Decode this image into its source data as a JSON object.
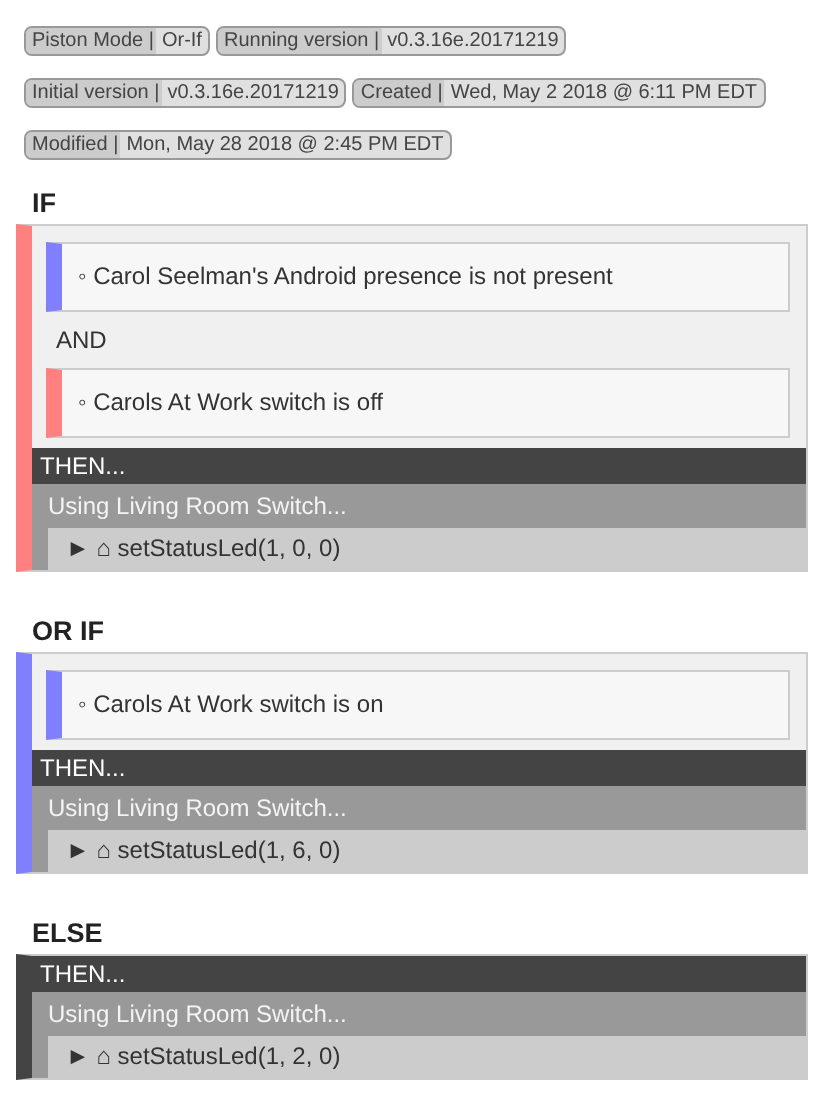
{
  "badges": [
    [
      {
        "label": "Piston Mode |",
        "value": "Or-If"
      },
      {
        "label": "Running version |",
        "value": "v0.3.16e.20171219"
      }
    ],
    [
      {
        "label": "Initial version |",
        "value": "v0.3.16e.20171219"
      },
      {
        "label": "Created |",
        "value": "Wed, May 2 2018 @ 6:11 PM EDT"
      }
    ],
    [
      {
        "label": "Modified |",
        "value": "Mon, May 28 2018 @ 2:45 PM EDT"
      }
    ]
  ],
  "blocks": [
    {
      "heading": "IF",
      "color": "#ff8080",
      "conditions": [
        {
          "kind": "condition",
          "text": "◦ Carol Seelman's Android presence is not present",
          "color": "#8080ff"
        },
        {
          "kind": "operator",
          "text": "AND"
        },
        {
          "kind": "condition",
          "text": "◦ Carols At Work switch is off",
          "color": "#ff8080"
        }
      ],
      "then": {
        "header": "THEN...",
        "device": "Using Living Room Switch...",
        "command": "► ⌂ setStatusLed(1, 0, 0)"
      }
    },
    {
      "heading": "OR IF",
      "color": "#8080ff",
      "conditions": [
        {
          "kind": "condition",
          "text": "◦ Carols At Work switch is on",
          "color": "#8080ff"
        }
      ],
      "then": {
        "header": "THEN...",
        "device": "Using Living Room Switch...",
        "command": "► ⌂ setStatusLed(1, 6, 0)"
      }
    },
    {
      "heading": "ELSE",
      "color": "#444444",
      "then": {
        "header": "THEN...",
        "device": "Using Living Room Switch...",
        "command": "► ⌂ setStatusLed(1, 2, 0)"
      }
    }
  ]
}
